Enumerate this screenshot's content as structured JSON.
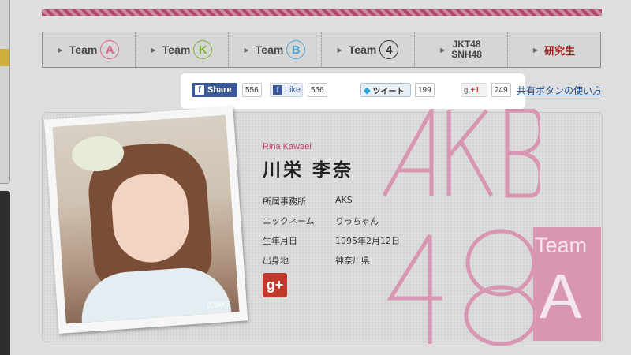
{
  "team_nav": [
    {
      "label": "Team",
      "badge": "A",
      "color": "#d7678f"
    },
    {
      "label": "Team",
      "badge": "K",
      "color": "#7bb23a"
    },
    {
      "label": "Team",
      "badge": "B",
      "color": "#4ca4d6"
    },
    {
      "label": "Team",
      "badge": "4",
      "color": "#333333"
    },
    {
      "line1": "JKT48",
      "line2": "SNH48"
    },
    {
      "label": "研究生",
      "color": "#a01e1e"
    }
  ],
  "share": {
    "fb_share_label": "Share",
    "fb_share_count": "556",
    "fb_like_label": "Like",
    "fb_like_count": "556",
    "tweet_label": "ツイート",
    "tweet_count": "199",
    "gplus_label": "+1",
    "gplus_count": "249",
    "howto_link": "共有ボタンの使い方"
  },
  "profile": {
    "name_romaji": "Rina Kawaei",
    "name_kanji": "川栄 李奈",
    "photo_credit": "(C)AKS",
    "fields": [
      {
        "key": "所属事務所",
        "value": "AKS"
      },
      {
        "key": "ニックネーム",
        "value": "りっちゃん"
      },
      {
        "key": "生年月日",
        "value": "1995年2月12日"
      },
      {
        "key": "出身地",
        "value": "神奈川県"
      }
    ],
    "gplus_icon": "g+"
  },
  "brand": {
    "logo_text": "AKB48",
    "team_text": "Team",
    "team_letter": "A",
    "accent": "#d896b3"
  }
}
